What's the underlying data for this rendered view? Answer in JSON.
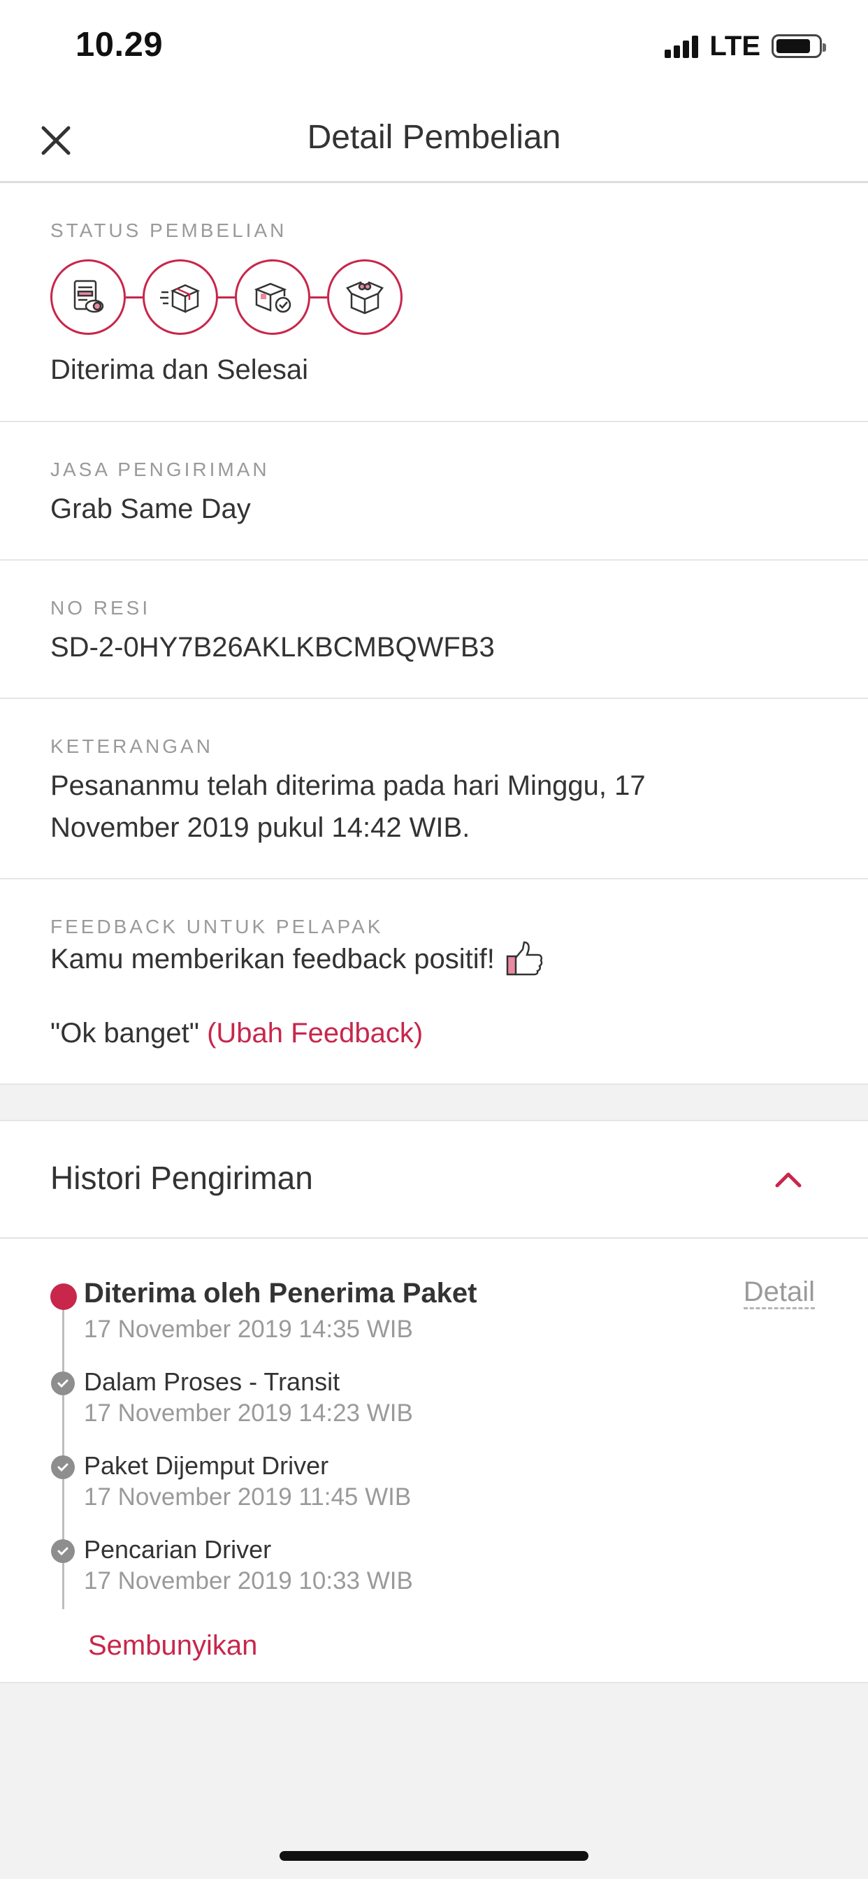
{
  "status_bar": {
    "time": "10.29",
    "network": "LTE"
  },
  "nav": {
    "title": "Detail Pembelian",
    "close_icon": "close-icon"
  },
  "colors": {
    "accent": "#c8264b",
    "muted": "#9a9a9a",
    "text": "#333333",
    "background": "#f2f2f2"
  },
  "purchase_status": {
    "label": "STATUS PEMBELIAN",
    "steps": [
      "invoice-icon",
      "shipping-box-icon",
      "box-check-icon",
      "open-gift-box-icon"
    ],
    "value": "Diterima dan Selesai"
  },
  "shipping_service": {
    "label": "JASA PENGIRIMAN",
    "value": "Grab Same Day"
  },
  "receipt": {
    "label": "NO RESI",
    "value": "SD-2-0HY7B26AKLKBCMBQWFB3"
  },
  "notes": {
    "label": "KETERANGAN",
    "line1": "Pesananmu telah diterima pada hari Minggu, 17",
    "line2": "November 2019 pukul 14:42 WIB."
  },
  "feedback": {
    "label": "FEEDBACK UNTUK PELAPAK",
    "message": "Kamu memberikan feedback positif!",
    "icon": "thumbs-up-icon",
    "quote": "\"Ok banget\"",
    "change_link": "(Ubah Feedback)"
  },
  "history": {
    "title": "Histori Pengiriman",
    "toggle_icon": "chevron-up-icon",
    "detail_link": "Detail",
    "items": [
      {
        "title": "Diterima oleh Penerima Paket",
        "time": "17 November 2019 14:35 WIB"
      },
      {
        "title": "Dalam Proses - Transit",
        "time": "17 November 2019 14:23 WIB"
      },
      {
        "title": "Paket Dijemput Driver",
        "time": "17 November 2019 11:45 WIB"
      },
      {
        "title": "Pencarian Driver",
        "time": "17 November 2019 10:33 WIB"
      }
    ],
    "hide_link": "Sembunyikan"
  }
}
